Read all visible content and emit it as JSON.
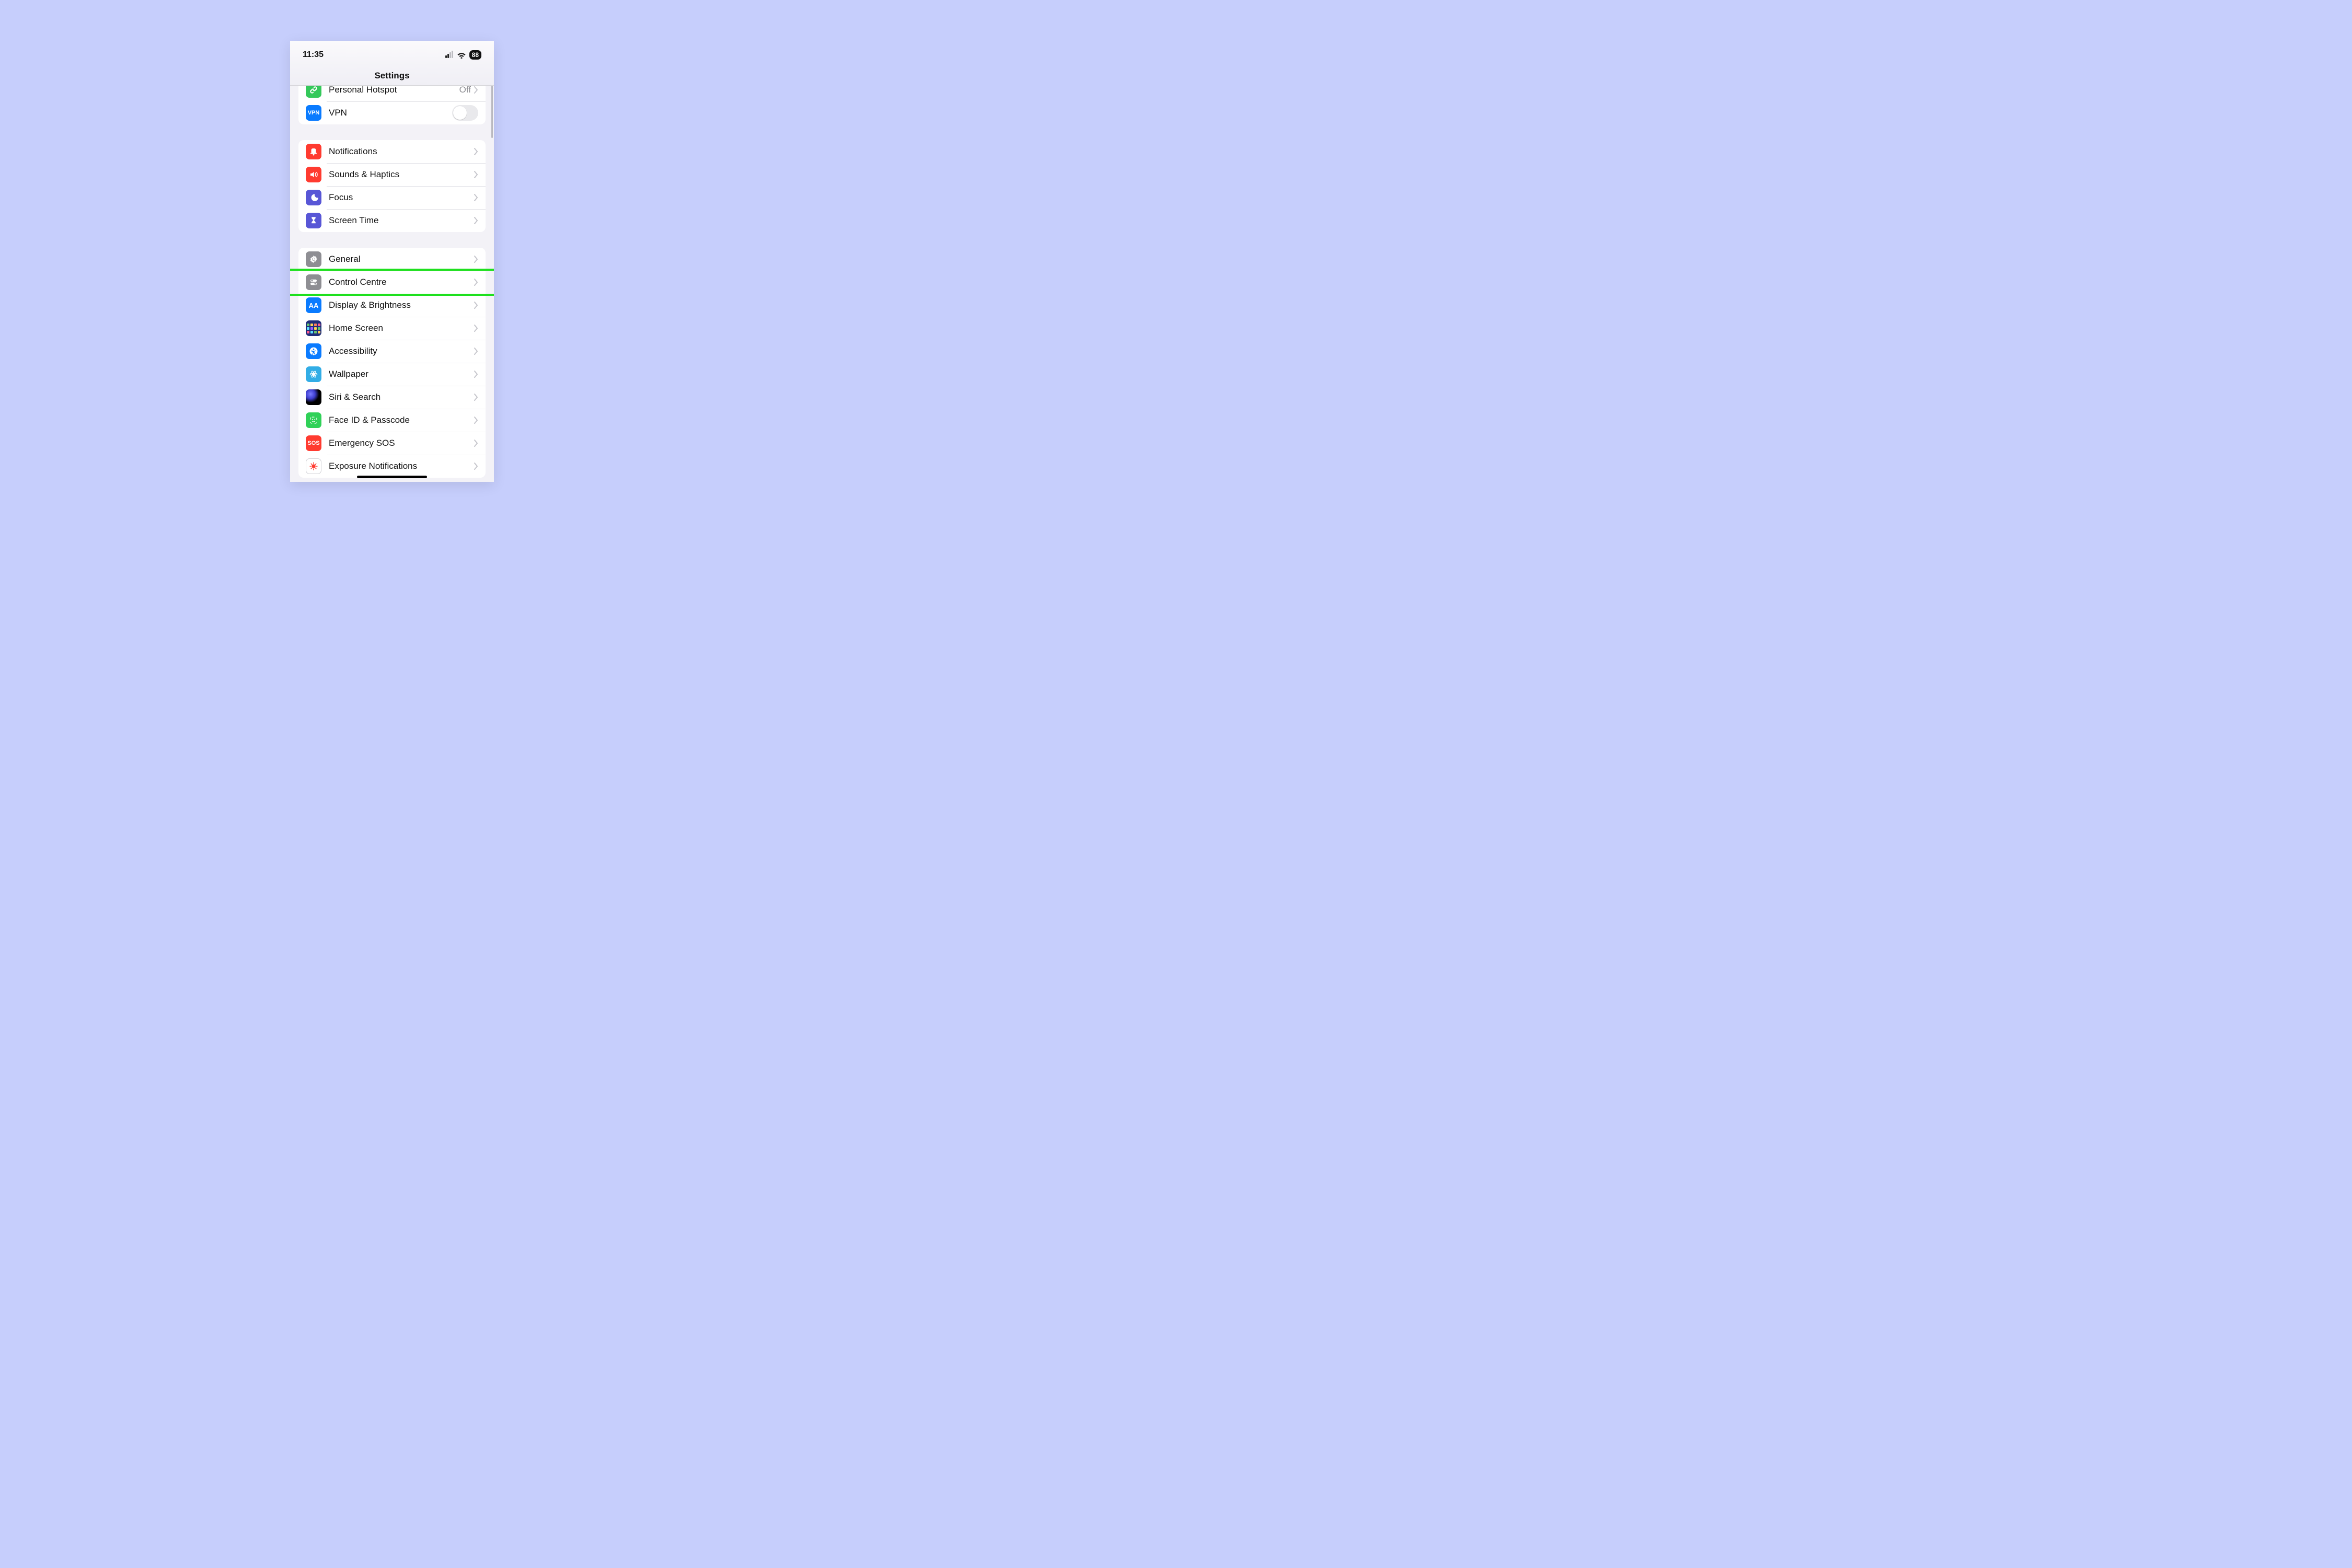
{
  "statusbar": {
    "time": "11:35",
    "battery": "88"
  },
  "title": "Settings",
  "highlight_row_key": "control_centre",
  "groups": [
    {
      "first_partial": true,
      "rows": [
        {
          "key": "hotspot",
          "label": "Personal Hotspot",
          "detail": "Off",
          "type": "disclosure",
          "icon": "link-icon",
          "icon_bg": "bg-green"
        },
        {
          "key": "vpn",
          "label": "VPN",
          "type": "toggle",
          "toggle_on": false,
          "icon": "vpn-icon",
          "icon_bg": "bg-blue"
        }
      ]
    },
    {
      "rows": [
        {
          "key": "notifications",
          "label": "Notifications",
          "type": "disclosure",
          "icon": "bell-icon",
          "icon_bg": "bg-red"
        },
        {
          "key": "sounds",
          "label": "Sounds & Haptics",
          "type": "disclosure",
          "icon": "speaker-icon",
          "icon_bg": "bg-red"
        },
        {
          "key": "focus",
          "label": "Focus",
          "type": "disclosure",
          "icon": "moon-icon",
          "icon_bg": "bg-indigo"
        },
        {
          "key": "screentime",
          "label": "Screen Time",
          "type": "disclosure",
          "icon": "hourglass-icon",
          "icon_bg": "bg-indigo"
        }
      ]
    },
    {
      "rows": [
        {
          "key": "general",
          "label": "General",
          "type": "disclosure",
          "icon": "gear-icon",
          "icon_bg": "bg-gray"
        },
        {
          "key": "control_centre",
          "label": "Control Centre",
          "type": "disclosure",
          "icon": "switches-icon",
          "icon_bg": "bg-gray"
        },
        {
          "key": "display",
          "label": "Display & Brightness",
          "type": "disclosure",
          "icon": "aa-icon",
          "icon_bg": "bg-blue"
        },
        {
          "key": "homescreen",
          "label": "Home Screen",
          "type": "disclosure",
          "icon": "grid-icon",
          "icon_bg": "bg-homescreen"
        },
        {
          "key": "accessibility",
          "label": "Accessibility",
          "type": "disclosure",
          "icon": "accessibility-icon",
          "icon_bg": "bg-blue"
        },
        {
          "key": "wallpaper",
          "label": "Wallpaper",
          "type": "disclosure",
          "icon": "flower-icon",
          "icon_bg": "bg-cyan"
        },
        {
          "key": "siri",
          "label": "Siri & Search",
          "type": "disclosure",
          "icon": "siri-icon",
          "icon_bg": "siri"
        },
        {
          "key": "faceid",
          "label": "Face ID & Passcode",
          "type": "disclosure",
          "icon": "face-icon",
          "icon_bg": "bg-facegrn"
        },
        {
          "key": "sos",
          "label": "Emergency SOS",
          "type": "disclosure",
          "icon": "sos-icon",
          "icon_bg": "bg-sosred"
        },
        {
          "key": "exposure",
          "label": "Exposure Notifications",
          "type": "disclosure",
          "icon": "covid-icon",
          "icon_bg": "bg-white"
        }
      ]
    }
  ]
}
